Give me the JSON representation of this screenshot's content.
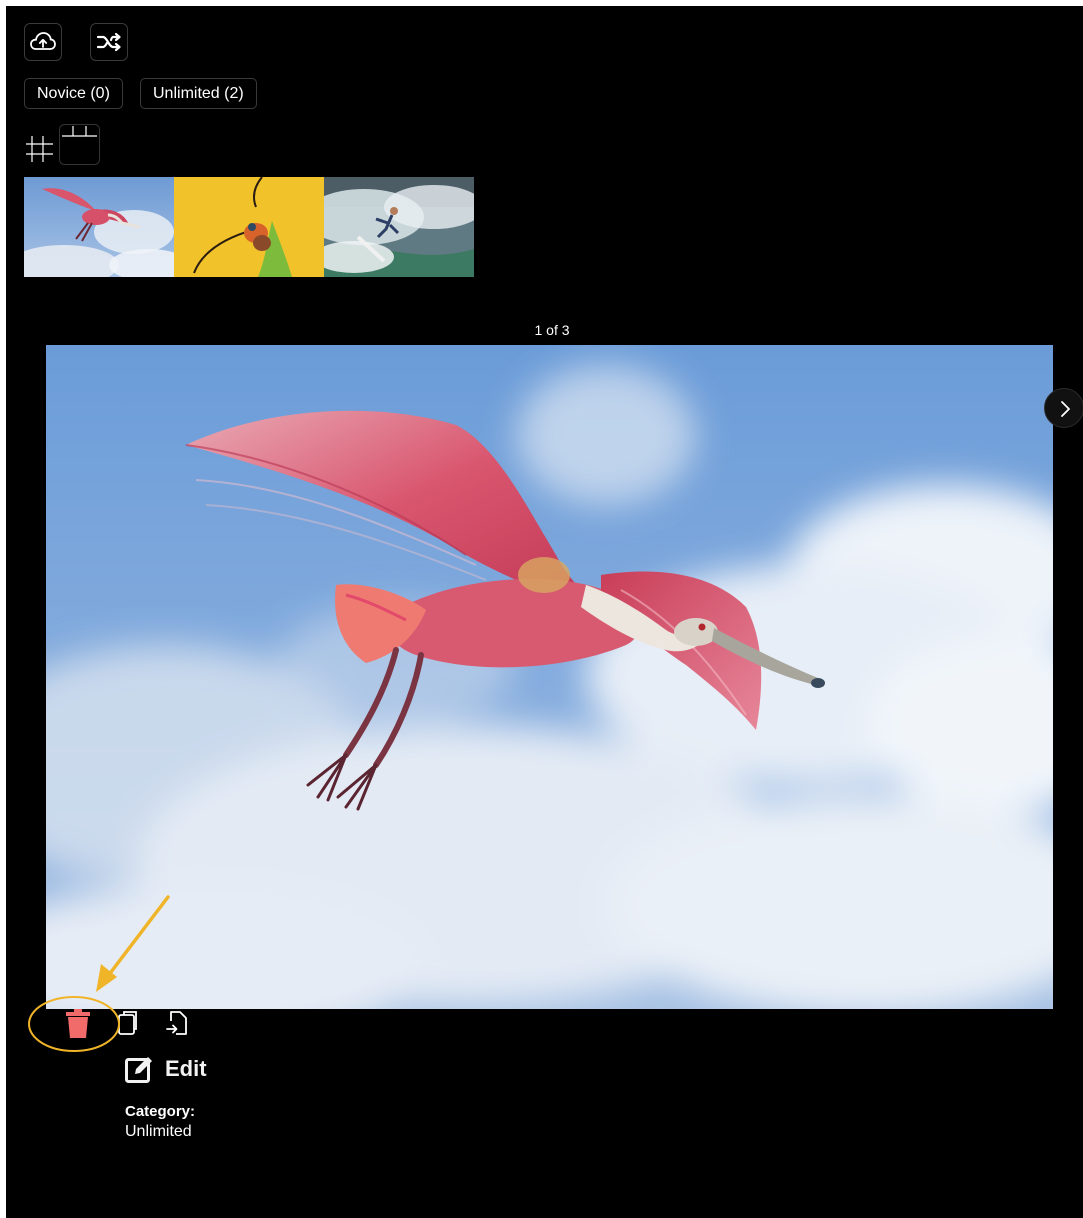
{
  "toolbar": {
    "upload_icon": "cloud-upload-icon",
    "shuffle_icon": "shuffle-icon"
  },
  "tabs": [
    {
      "label": "Novice (0)"
    },
    {
      "label": "Unlimited (2)"
    }
  ],
  "view_toggles": [
    "grid-view-icon",
    "columns-view-icon"
  ],
  "thumbnails": [
    {
      "subject": "spoonbill-thumbnail"
    },
    {
      "subject": "insect-on-yellow-thumbnail"
    },
    {
      "subject": "surfer-thumbnail"
    }
  ],
  "viewer": {
    "counter": "1 of 3",
    "next_icon": "chevron-right-icon"
  },
  "actions": {
    "delete_icon": "trash-icon",
    "copy_icon": "copy-icon",
    "move_icon": "move-file-icon"
  },
  "edit": {
    "label": "Edit"
  },
  "details": {
    "category_label": "Category:",
    "category_value": "Unlimited"
  },
  "colors": {
    "background": "#000000",
    "delete": "#f26b6b",
    "highlight": "#f0b429"
  }
}
